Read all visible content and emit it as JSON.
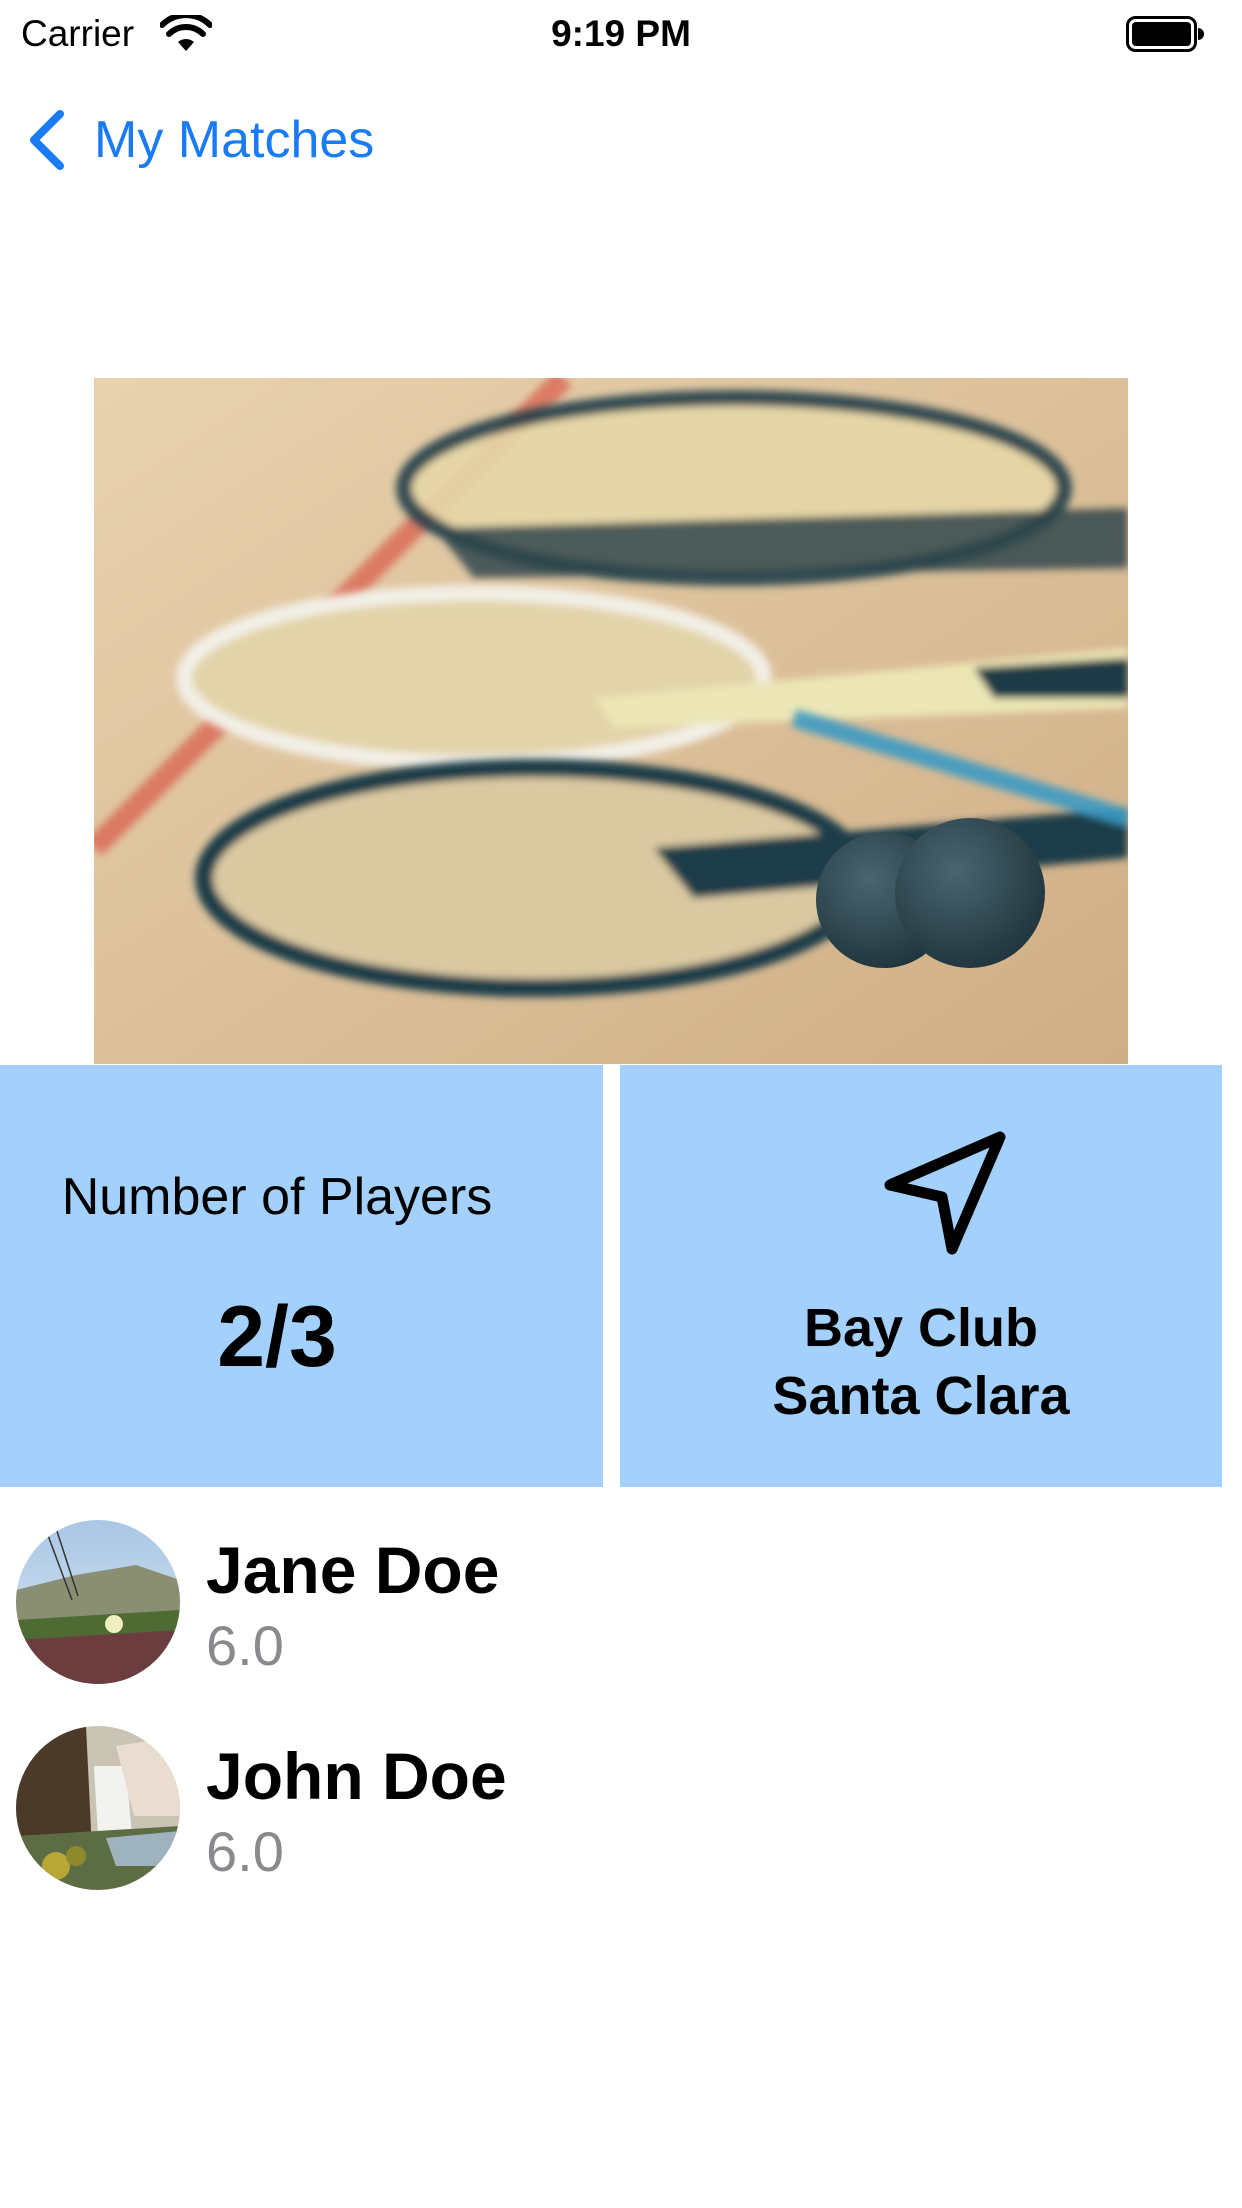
{
  "status_bar": {
    "carrier": "Carrier",
    "time": "9:19 PM",
    "icons": [
      "wifi-icon",
      "battery-icon"
    ]
  },
  "nav": {
    "back_label": "My Matches",
    "back_icon": "chevron-left-icon",
    "accent_color": "#1a7cf5"
  },
  "hero": {
    "icon": "squash-rackets-photo"
  },
  "match_info": {
    "tile_color": "#a3d1fb",
    "players_label": "Number of Players",
    "players_count": "2/3",
    "location_icon": "location-arrow-icon",
    "location_line_1": "Bay Club",
    "location_line_2": "Santa Clara"
  },
  "players": [
    {
      "name": "Jane Doe",
      "rating": "6.0",
      "avatar": "coastal-flowers-avatar"
    },
    {
      "name": "John Doe",
      "rating": "6.0",
      "avatar": "waterfall-avatar"
    }
  ],
  "colors": {
    "rating_text": "#8a8a8e",
    "background": "#ffffff"
  }
}
